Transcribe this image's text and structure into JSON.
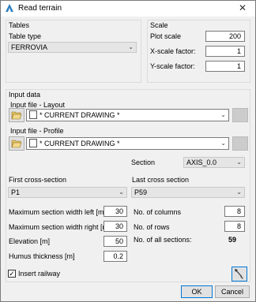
{
  "window": {
    "title": "Read terrain"
  },
  "tables": {
    "group_label": "Tables",
    "table_type_label": "Table type",
    "table_type_value": "FERROVIA"
  },
  "scale": {
    "group_label": "Scale",
    "plot_scale_label": "Plot scale",
    "plot_scale_value": "200",
    "x_scale_label": "X-scale factor:",
    "x_scale_value": "1",
    "y_scale_label": "Y-scale factor:",
    "y_scale_value": "1"
  },
  "input": {
    "group_label": "Input data",
    "layout_label": "Input file - Layout",
    "layout_value": "* CURRENT DRAWING *",
    "profile_label": "Input file - Profile",
    "profile_value": "* CURRENT DRAWING *",
    "section_label": "Section",
    "section_value": "AXIS_0.0",
    "first_cs_label": "First cross-section",
    "first_cs_value": "P1",
    "last_cs_label": "Last cross section",
    "last_cs_value": "P59",
    "max_left_label": "Maximum section width left [m]",
    "max_left_value": "30",
    "max_right_label": "Maximum section width right [m]",
    "max_right_value": "30",
    "elevation_label": "Elevation [m]",
    "elevation_value": "50",
    "humus_label": "Humus thickness [m]",
    "humus_value": "0.2",
    "columns_label": "No. of columns",
    "columns_value": "8",
    "rows_label": "No. of rows",
    "rows_value": "8",
    "all_sections_label": "No. of all sections:",
    "all_sections_value": "59"
  },
  "insert_railway_label": "Insert railway",
  "insert_railway_checked": "✓",
  "ok_label": "OK",
  "cancel_label": "Cancel"
}
